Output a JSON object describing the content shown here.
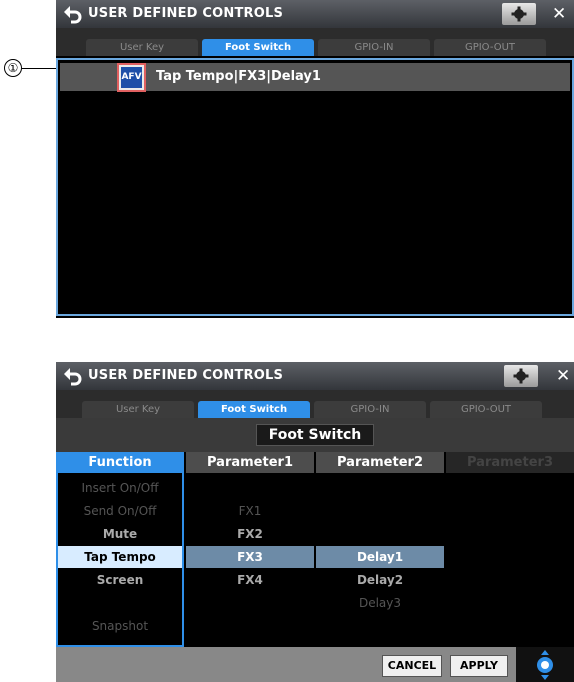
{
  "app": {
    "title": "USER DEFINED CONTROLS"
  },
  "tabs": [
    "User Key",
    "Foot Switch",
    "GPIO-IN",
    "GPIO-OUT"
  ],
  "active_tab": "Foot Switch",
  "callout": {
    "number": "①"
  },
  "list": {
    "rows": [
      {
        "badge": "AFV",
        "text": "Tap Tempo|FX3|Delay1"
      }
    ]
  },
  "editor": {
    "header": "Foot Switch",
    "columns": {
      "function": "Function",
      "parameter1": "Parameter1",
      "parameter2": "Parameter2",
      "parameter3": "Parameter3"
    },
    "functions": [
      "Insert On/Off",
      "Send On/Off",
      "Mute",
      "Tap Tempo",
      "Screen",
      "",
      "Snapshot"
    ],
    "selected_function": "Tap Tempo",
    "parameter1": [
      "FX1",
      "FX2",
      "FX3",
      "FX4"
    ],
    "selected_parameter1": "FX3",
    "parameter2": [
      "Delay1",
      "Delay2",
      "Delay3"
    ],
    "selected_parameter2": "Delay1"
  },
  "buttons": {
    "cancel": "CANCEL",
    "apply": "APPLY"
  },
  "colors": {
    "accent": "#2f8fe8",
    "selection": "#d8ecff",
    "afv_badge": "#1e4fa8",
    "callout_border": "#e06060"
  },
  "icons": [
    "back-icon",
    "gear-icon",
    "close-icon",
    "jog-wheel-icon"
  ]
}
